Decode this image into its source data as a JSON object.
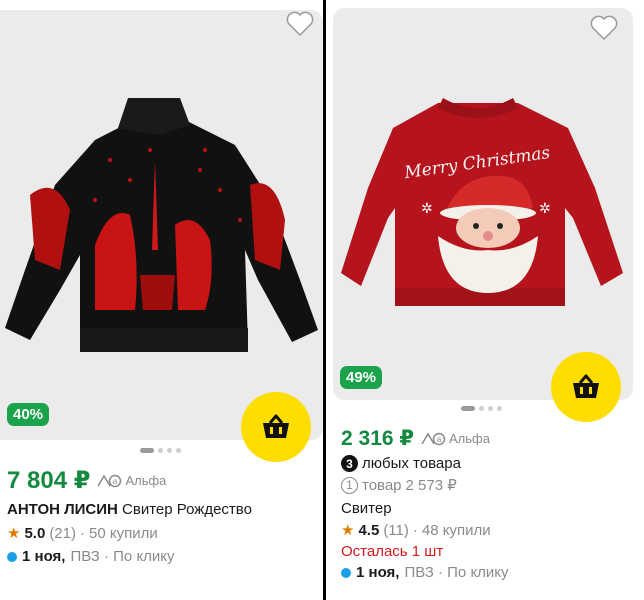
{
  "cards": [
    {
      "discount": "40%",
      "price": "7 804 ₽",
      "alfa_label": "Альфа",
      "brand": "АНТОН ЛИСИН",
      "title": "Свитер Рождество",
      "rating": "5.0",
      "reviews": "(21)",
      "sep": "·",
      "bought": "50 купили",
      "delivery_day": "1 ноя,",
      "delivery_rest": "ПВЗ · По клику"
    },
    {
      "discount": "49%",
      "price": "2 316 ₽",
      "alfa_label": "Альфа",
      "bundle_count": "3",
      "bundle_text": "любых товара",
      "single_count": "1",
      "single_text": "товар",
      "single_price": "2 573 ₽",
      "title": "Свитер",
      "rating": "4.5",
      "reviews": "(11)",
      "sep": "·",
      "bought": "48 купили",
      "stock": "Осталась 1 шт",
      "delivery_day": "1 ноя,",
      "delivery_rest": "ПВЗ · По клику",
      "sweater_text": "Merry Christmas"
    }
  ],
  "colors": {
    "price": "#138a3f",
    "discount": "#1aa34a",
    "cart": "#ffdd00",
    "stock": "#d11a1a",
    "delivery_dot": "#1aa0e8"
  },
  "icons": [
    "heart-icon",
    "cart-icon",
    "alfa-icon",
    "star-icon"
  ]
}
